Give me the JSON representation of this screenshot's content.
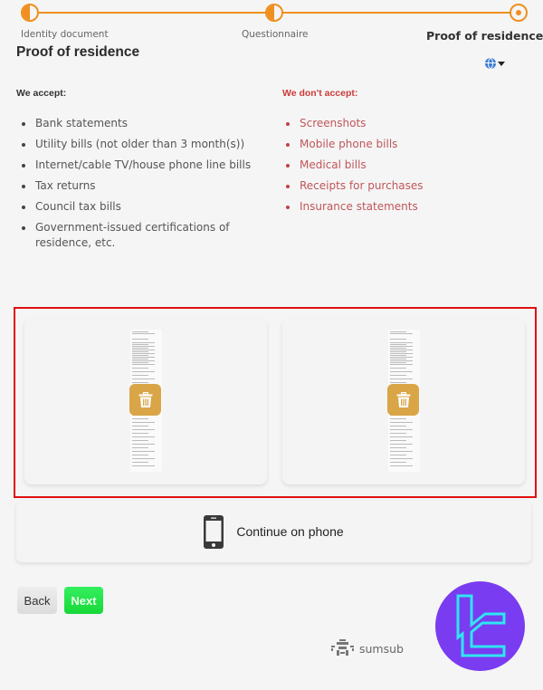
{
  "stepper": {
    "steps": [
      {
        "label": "Identity document",
        "state": "partial"
      },
      {
        "label": "Questionnaire",
        "state": "partial"
      },
      {
        "label": "Proof of residence",
        "state": "current"
      }
    ]
  },
  "page": {
    "title": "Proof of residence",
    "language_icon": "globe-icon"
  },
  "accept": {
    "heading": "We accept:",
    "items": [
      "Bank statements",
      "Utility bills (not older than 3 month(s))",
      "Internet/cable TV/house phone line bills",
      "Tax returns",
      "Council tax bills",
      "Government-issued certifications of residence, etc."
    ]
  },
  "reject": {
    "heading": "We don't accept:",
    "items": [
      "Screenshots",
      "Mobile phone bills",
      "Medical bills",
      "Receipts for purchases",
      "Insurance statements"
    ]
  },
  "uploads": {
    "documents": [
      {
        "icon": "trash-icon"
      },
      {
        "icon": "trash-icon"
      }
    ]
  },
  "actions": {
    "continue_on_phone": "Continue on phone",
    "back": "Back",
    "next": "Next"
  },
  "footer": {
    "powered_by": "sumsub"
  },
  "colors": {
    "accent": "#ef8f1f",
    "reject": "#cc3a3a",
    "trash": "#d9a547",
    "next": "#22e04a",
    "highlight": "#e01010",
    "brand_bg": "#7a3cf0",
    "brand_fg": "#2ee6f2"
  }
}
